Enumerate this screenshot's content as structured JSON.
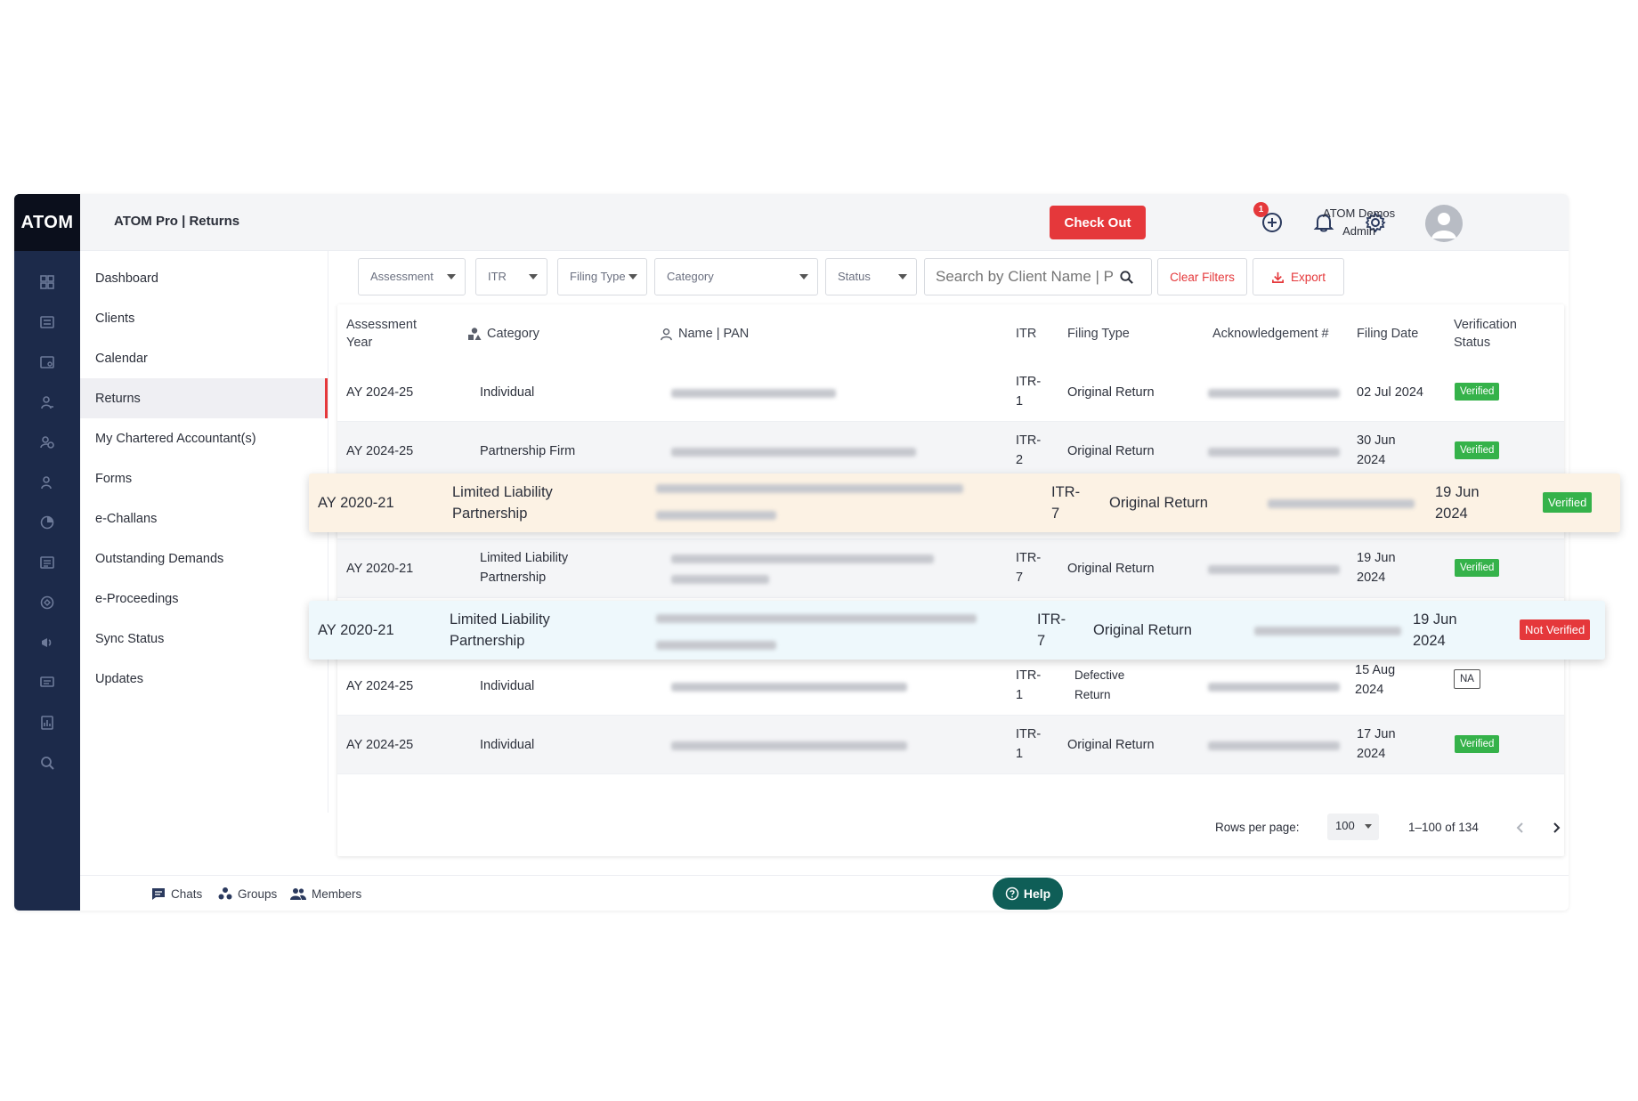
{
  "app": {
    "logo": "ATOM",
    "title": "ATOM Pro | Returns"
  },
  "header": {
    "checkout_label": "Check Out",
    "notification_count": "1",
    "user_name": "ATOM Demos",
    "user_role": "Admin"
  },
  "sidebar": {
    "items": [
      {
        "label": "Dashboard"
      },
      {
        "label": "Clients"
      },
      {
        "label": "Calendar"
      },
      {
        "label": "Returns",
        "active": true
      },
      {
        "label": "My Chartered Accountant(s)"
      },
      {
        "label": "Forms"
      },
      {
        "label": "e-Challans"
      },
      {
        "label": "Outstanding Demands"
      },
      {
        "label": "e-Proceedings"
      },
      {
        "label": "Sync Status"
      },
      {
        "label": "Updates"
      }
    ]
  },
  "filters": {
    "assessment": "Assessment",
    "itr": "ITR",
    "filing_type": "Filing Type",
    "category": "Category",
    "status": "Status",
    "search_placeholder": "Search by Client Name | P",
    "clear_label": "Clear Filters",
    "export_label": "Export"
  },
  "table": {
    "headers": {
      "assessment_year": "Assessment Year",
      "category": "Category",
      "name_pan": "Name | PAN",
      "itr": "ITR",
      "filing_type": "Filing Type",
      "acknowledgement": "Acknowledgement #",
      "filing_date": "Filing Date",
      "verification": "Verification Status"
    },
    "rows": [
      {
        "year": "AY 2024-25",
        "category": "Individual",
        "itr": "ITR-1",
        "filing_type": "Original Return",
        "filing_date": "02 Jul 2024",
        "status": "Verified"
      },
      {
        "year": "AY 2024-25",
        "category": "Partnership Firm",
        "itr": "ITR-2",
        "filing_type": "Original Return",
        "filing_date": "30 Jun 2024",
        "status": "Verified"
      },
      {
        "year": "AY 2020-21",
        "category": "Limited Liability Partnership",
        "itr": "ITR-7",
        "filing_type": "Original Return",
        "filing_date": "19 Jun 2024",
        "status": "Verified"
      },
      {
        "year": "AY 2020-21",
        "category": "Limited Liability Partnership",
        "itr": "ITR-7",
        "filing_type": "Original Return",
        "filing_date": "19 Jun 2024",
        "status": "Verified"
      },
      {
        "year": "AY 2020-21",
        "category": "Limited Liability Partnership",
        "itr": "ITR-7",
        "filing_type": "Original Return",
        "filing_date": "19 Jun 2024",
        "status": "Not Verified"
      },
      {
        "year": "AY 2024-25",
        "category": "Individual",
        "itr": "ITR-1",
        "filing_type": "Defective Return",
        "filing_date": "15 Aug 2024",
        "status": "NA"
      },
      {
        "year": "AY 2024-25",
        "category": "Individual",
        "itr": "ITR-1",
        "filing_type": "Original Return",
        "filing_date": "17 Jun 2024",
        "status": "Verified"
      }
    ]
  },
  "pagination": {
    "rows_per_page_label": "Rows per page:",
    "rows_per_page": "100",
    "range": "1–100 of 134"
  },
  "footer": {
    "chats": "Chats",
    "groups": "Groups",
    "members": "Members",
    "help": "Help"
  },
  "colors": {
    "accent": "#e5383b",
    "rail": "#1c2a4a",
    "verified": "#35b24a",
    "help": "#0f5e57"
  }
}
